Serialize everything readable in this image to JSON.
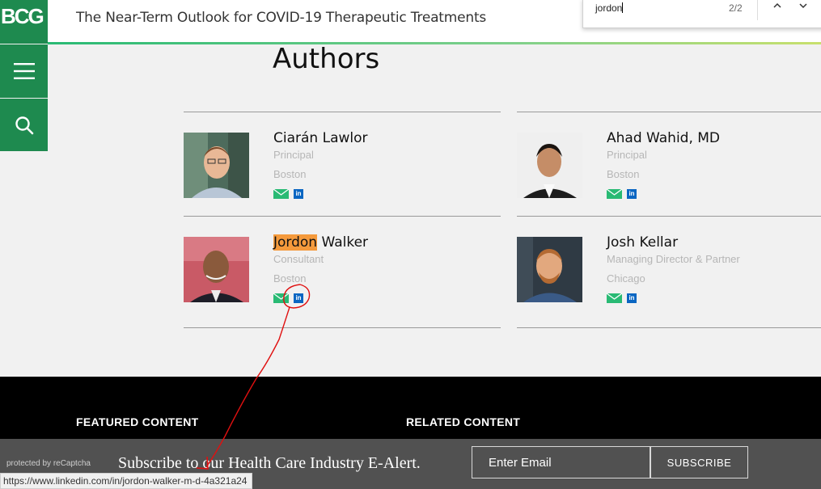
{
  "header": {
    "logo": "BCG",
    "title": "The Near-Term Outlook for COVID-19 Therapeutic Treatments"
  },
  "find_bar": {
    "query": "jordon",
    "count": "2/2",
    "up_icon": "chevron-up-icon",
    "down_icon": "chevron-down-icon"
  },
  "side_nav": {
    "menu_icon": "hamburger-menu-icon",
    "search_icon": "search-icon"
  },
  "authors": {
    "heading": "Authors",
    "items": [
      {
        "first": "Ciarán",
        "last": "Lawlor",
        "role": "Principal",
        "city": "Boston"
      },
      {
        "first": "Ahad",
        "last": "Wahid, MD",
        "role": "Principal",
        "city": "Boston"
      },
      {
        "first": "Jordon",
        "last": "Walker",
        "role": "Consultant",
        "city": "Boston"
      },
      {
        "first": "Josh",
        "last": "Kellar",
        "role": "Managing Director & Partner",
        "city": "Chicago"
      }
    ],
    "linkedin_label": "in"
  },
  "footer": {
    "featured": "FEATURED CONTENT",
    "related": "RELATED CONTENT"
  },
  "subscribe": {
    "recaptcha": "protected by reCaptcha",
    "text": "Subscribe to our Health Care Industry E-Alert.",
    "placeholder": "Enter Email",
    "button": "SUBSCRIBE"
  },
  "status_bar": {
    "url": "https://www.linkedin.com/in/jordon-walker-m-d-4a321a24"
  },
  "colors": {
    "brand_green": "#1e8a4f",
    "highlight": "#f59a3c",
    "linkedin": "#0a66c2",
    "annotation_red": "#e01010"
  }
}
